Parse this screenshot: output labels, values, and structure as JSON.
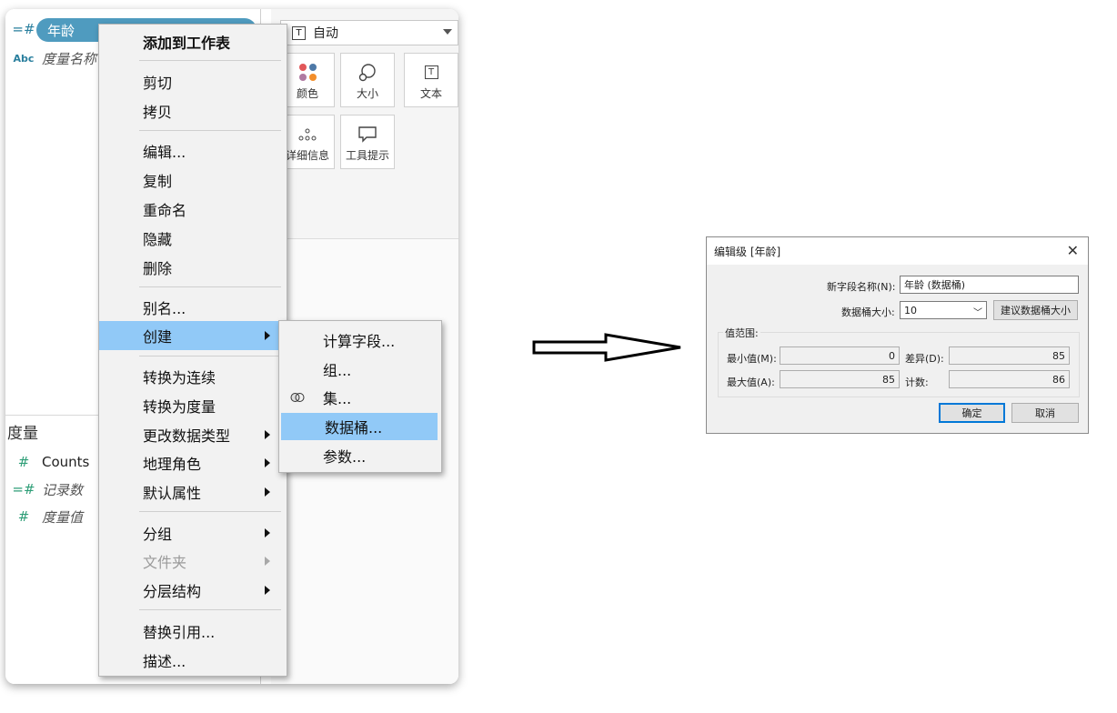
{
  "data_pane": {
    "pill_label": "年龄",
    "dim_row2": "度量名称",
    "measures_title": "度量",
    "measures": [
      "Counts",
      "记录数",
      "度量值"
    ]
  },
  "marks": {
    "mark_type": "自动",
    "buttons": [
      "颜色",
      "大小",
      "文本",
      "详细信息",
      "工具提示"
    ],
    "dot_colors": [
      "#e15759",
      "#4e79a7",
      "#b07aa1",
      "#f28e2b"
    ]
  },
  "context_menu": {
    "items": {
      "add_to_sheet": "添加到工作表",
      "cut": "剪切",
      "copy": "拷贝",
      "edit": "编辑...",
      "duplicate": "复制",
      "rename": "重命名",
      "hide": "隐藏",
      "delete": "删除",
      "alias": "别名...",
      "create": "创建",
      "convert_continuous": "转换为连续",
      "convert_measure": "转换为度量",
      "change_type": "更改数据类型",
      "geo_role": "地理角色",
      "default_props": "默认属性",
      "group": "分组",
      "folder": "文件夹",
      "hierarchy": "分层结构",
      "replace_ref": "替换引用...",
      "describe": "描述..."
    }
  },
  "create_submenu": {
    "items": {
      "calc_field": "计算字段...",
      "group": "组...",
      "set": "集...",
      "bins": "数据桶...",
      "parameter": "参数..."
    }
  },
  "dialog": {
    "title": "编辑级 [年龄]",
    "close": "✕",
    "new_field_label": "新字段名称(N):",
    "new_field_value": "年龄 (数据桶)",
    "bin_size_label": "数据桶大小:",
    "bin_size_value": "10",
    "suggest_button": "建议数据桶大小",
    "range_title": "值范围:",
    "min_label": "最小值(M):",
    "min_value": "0",
    "diff_label": "差异(D):",
    "diff_value": "85",
    "max_label": "最大值(A):",
    "max_value": "85",
    "count_label": "计数:",
    "count_value": "86",
    "ok": "确定",
    "cancel": "取消"
  }
}
